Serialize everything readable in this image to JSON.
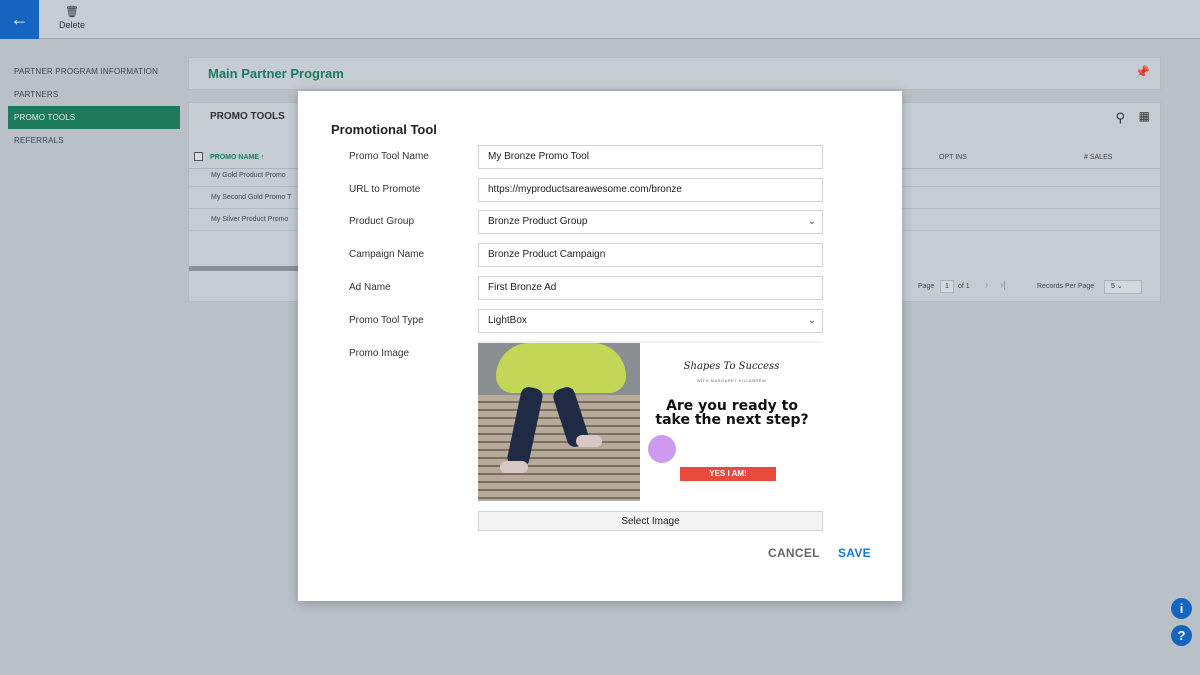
{
  "toolbar": {
    "back_icon": "arrow-left-icon",
    "delete_label": "Delete",
    "delete_icon": "trash-icon"
  },
  "sidebar": {
    "items": [
      {
        "label": "PARTNER PROGRAM INFORMATION",
        "active": false
      },
      {
        "label": "PARTNERS",
        "active": false
      },
      {
        "label": "PROMO TOOLS",
        "active": true
      },
      {
        "label": "REFERRALS",
        "active": false
      }
    ]
  },
  "header": {
    "title": "Main Partner Program",
    "pin_icon": "pin-icon"
  },
  "grid": {
    "title": "PROMO TOOLS",
    "columns": {
      "name": "PROMO NAME ↑",
      "opt_ins": "OPT INS",
      "sales": "# SALES"
    },
    "rows": [
      "My Gold Product Promo",
      "My Second Gold Promo T",
      "My Silver Product Promo"
    ],
    "pager": {
      "page_label": "Page",
      "page": "1",
      "of_label": "of 1",
      "records_label": "Records Per Page",
      "records_value": "5"
    }
  },
  "modal": {
    "title": "Promotional Tool",
    "fields": {
      "promo_tool_name": {
        "label": "Promo Tool Name",
        "value": "My Bronze Promo Tool"
      },
      "url": {
        "label": "URL to Promote",
        "value": "https://myproductsareawesome.com/bronze"
      },
      "product_group": {
        "label": "Product Group",
        "value": "Bronze Product Group"
      },
      "campaign_name": {
        "label": "Campaign Name",
        "value": "Bronze Product Campaign"
      },
      "ad_name": {
        "label": "Ad Name",
        "value": "First Bronze Ad"
      },
      "promo_tool_type": {
        "label": "Promo Tool Type",
        "value": "LightBox"
      },
      "promo_image": {
        "label": "Promo Image"
      }
    },
    "image": {
      "logo": "Shapes To Success",
      "logo_sub": "WITH MARGARET KILLABREW",
      "headline": "Are you ready to take the next step?",
      "cta": "YES I AM!"
    },
    "select_image_label": "Select Image",
    "cancel_label": "CANCEL",
    "save_label": "SAVE"
  },
  "help": {
    "info": "i",
    "question": "?"
  },
  "colors": {
    "primary": "#1565c0",
    "accent_green": "#1d7a5b",
    "save_blue": "#1976d2",
    "cta_red": "#e84a3c"
  }
}
